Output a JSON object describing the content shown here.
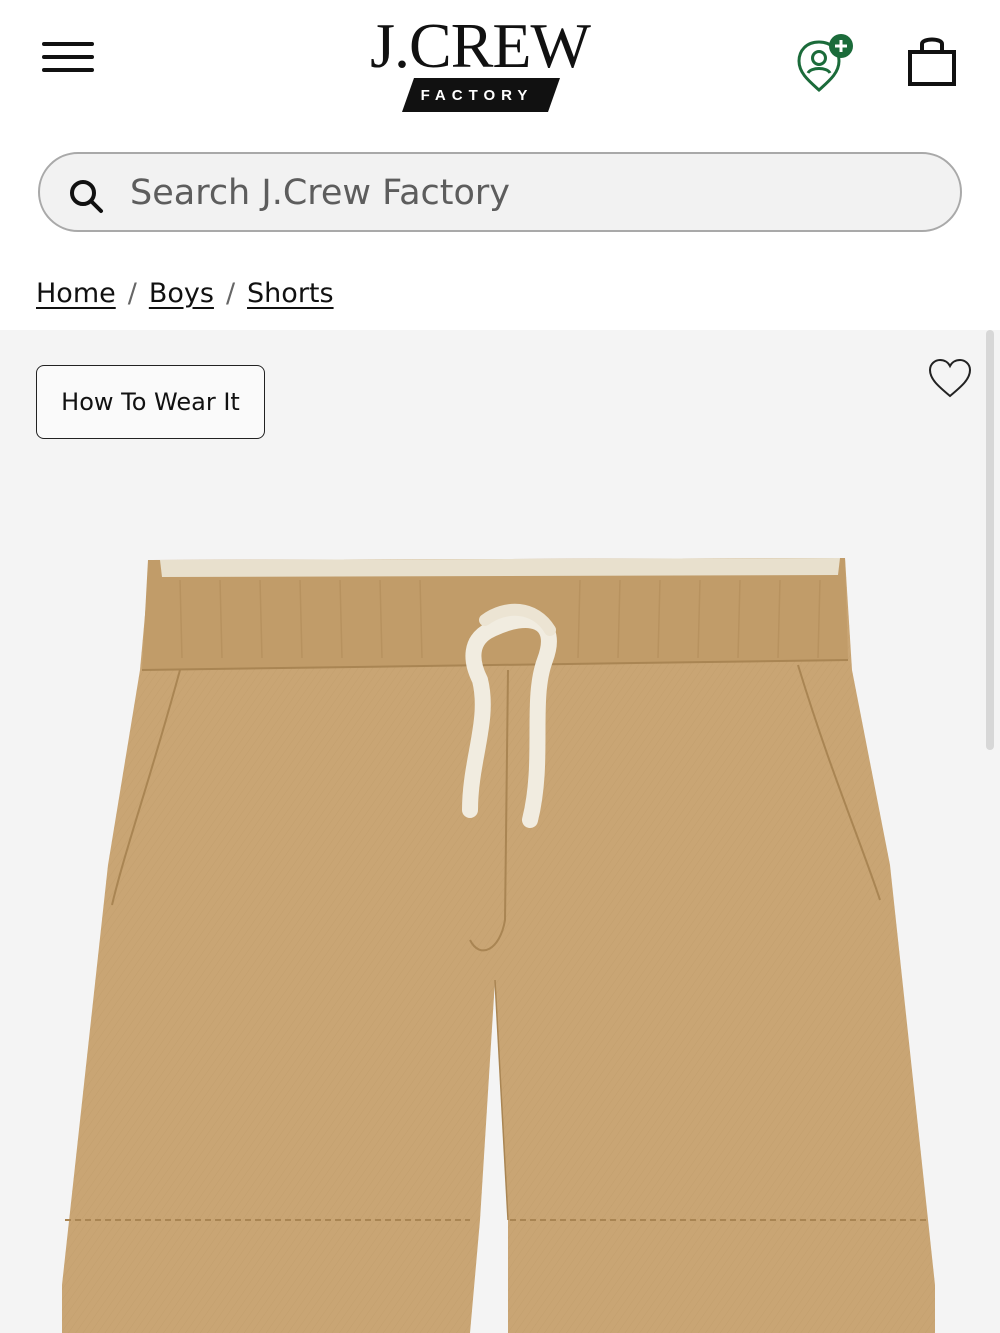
{
  "header": {
    "menu_icon": "hamburger-menu-icon",
    "logo": {
      "brand": "J.CREW",
      "sub": "FACTORY"
    },
    "account_icon": "account-location-icon",
    "bag_icon": "shopping-bag-icon",
    "accent_color": "#1b6b3a"
  },
  "search": {
    "icon": "search-icon",
    "placeholder": "Search J.Crew Factory",
    "value": ""
  },
  "breadcrumb": {
    "items": [
      {
        "label": "Home"
      },
      {
        "label": "Boys"
      },
      {
        "label": "Shorts"
      }
    ],
    "separator": "/"
  },
  "product": {
    "how_to_wear_label": "How To Wear It",
    "wishlist_icon": "heart-icon",
    "image": {
      "subject": "khaki pull-on shorts with drawstring",
      "color": "#c9a574"
    }
  }
}
